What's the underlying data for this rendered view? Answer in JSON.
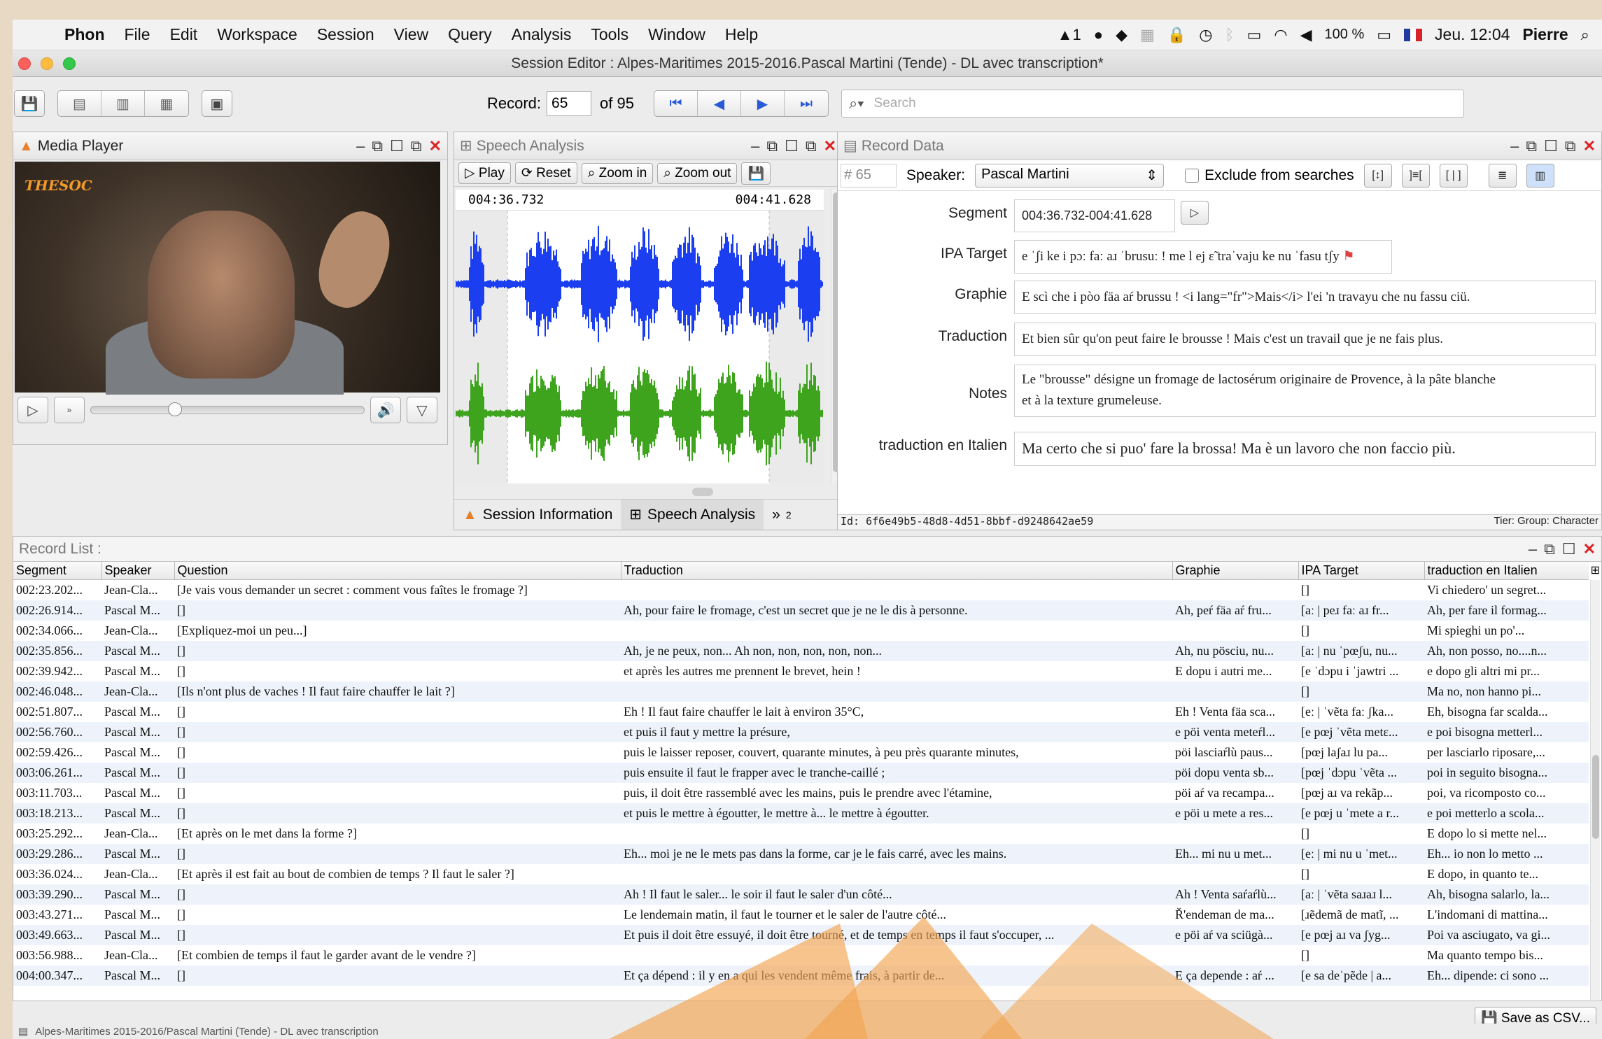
{
  "menubar": {
    "app": "Phon",
    "items": [
      "File",
      "Edit",
      "Workspace",
      "Session",
      "View",
      "Query",
      "Analysis",
      "Tools",
      "Window",
      "Help"
    ],
    "status": {
      "adobe": "1",
      "battery": "100 %",
      "clock": "Jeu. 12:04",
      "user": "Pierre"
    }
  },
  "window": {
    "title": "Session Editor : Alpes-Maritimes 2015-2016.Pascal Martini (Tende) - DL avec transcription*"
  },
  "toolbar": {
    "record_label": "Record:",
    "record_value": "65",
    "of_label": "of 95",
    "search_placeholder": "Search"
  },
  "media_player": {
    "title": "Media Player",
    "logo_text": "THESOC"
  },
  "speech_analysis": {
    "title": "Speech Analysis",
    "buttons": {
      "play": "Play",
      "reset": "Reset",
      "zoom_in": "Zoom in",
      "zoom_out": "Zoom out"
    },
    "start_time": "004:36.732",
    "end_time": "004:41.628",
    "waveform_colors": {
      "top": "#1a3ef0",
      "bottom": "#3ea41e"
    },
    "tabs": {
      "session_info": "Session Information",
      "speech_analysis": "Speech Analysis",
      "more": "»",
      "more_count": "2"
    }
  },
  "record_data": {
    "title": "Record Data",
    "record_number": "# 65",
    "speaker_label": "Speaker:",
    "speaker_value": "Pascal Martini",
    "exclude_label": "Exclude from searches",
    "fields": {
      "segment": {
        "label": "Segment",
        "value": "004:36.732-004:41.628"
      },
      "ipa_target": {
        "label": "IPA Target",
        "value": "e ˈʃi ke i pɔː faː aɹ ˈbrusuː ! me l ej ɛ̃ traˈvaju ke nu ˈfasu tʃy"
      },
      "graphie": {
        "label": "Graphie",
        "value": "E scì che i pòo fäa aŕ brussu ! <i lang=\"fr\">Mais</i> l'ei 'n travayu che nu fassu ciü."
      },
      "traduction": {
        "label": "Traduction",
        "value": "Et bien sûr qu'on peut faire le brousse ! Mais c'est un travail que je ne fais plus."
      },
      "notes": {
        "label": "Notes",
        "line1": "Le \"brousse\" désigne un fromage de lactosérum originaire de Provence, à la pâte blanche",
        "line2": "et à la texture grumeleuse."
      },
      "italien": {
        "label": "traduction en Italien",
        "value": "Ma certo che si puo' fare la brossa! Ma è un lavoro che non faccio più."
      }
    },
    "id": "Id: 6f6e49b5-48d8-4d51-8bbf-d9248642ae59",
    "tier": "Tier:  Group:  Character"
  },
  "record_list": {
    "title": "Record List :",
    "columns": [
      "Segment",
      "Speaker",
      "Question",
      "Traduction",
      "Graphie",
      "IPA Target",
      "traduction en Italien"
    ],
    "rows": [
      [
        "002:23.202...",
        "Jean-Cla...",
        "[Je vais vous demander un secret : comment vous faîtes le fromage ?]",
        "",
        "",
        "[]",
        "Vi chiedero' un segret..."
      ],
      [
        "002:26.914...",
        "Pascal M...",
        "[]",
        "Ah, pour faire le fromage, c'est un secret que je ne le dis à personne.",
        "Ah, peŕ fäa aŕ fru...",
        "[aː | peɹ faː aɹ fr...",
        "Ah, per fare il formag..."
      ],
      [
        "002:34.066...",
        "Jean-Cla...",
        "[Expliquez-moi un peu...]",
        "",
        "",
        "[]",
        "Mi spieghi un po'..."
      ],
      [
        "002:35.856...",
        "Pascal M...",
        "[]",
        "Ah, je ne peux, non... Ah non, non, non, non, non...",
        "Ah, nu pösciu, nu...",
        "[aː | nu ˈpœʃu, nu...",
        "Ah, non posso, no....n..."
      ],
      [
        "002:39.942...",
        "Pascal M...",
        "[]",
        "et après les autres me prennent le brevet, hein !",
        "E dopu i autri me...",
        "[e ˈdɔpu i ˈjawtri ...",
        "e dopo gli altri mi pr..."
      ],
      [
        "002:46.048...",
        "Jean-Cla...",
        "[Ils n'ont plus de vaches ! Il faut faire chauffer le lait ?]",
        "",
        "",
        "[]",
        "Ma no, non hanno pi..."
      ],
      [
        "002:51.807...",
        "Pascal M...",
        "[]",
        "Eh ! Il faut faire chauffer le lait à environ 35°C,",
        "Eh ! Venta fäa sca...",
        "[eː | ˈvẽta faː ʃka...",
        "Eh, bisogna far scalda..."
      ],
      [
        "002:56.760...",
        "Pascal M...",
        "[]",
        "et puis il faut y mettre la présure,",
        "e pöi venta meteŕl...",
        "[e pœj ˈvẽta metɛ...",
        "e poi bisogna metterl..."
      ],
      [
        "002:59.426...",
        "Pascal M...",
        "[]",
        "puis le laisser reposer, couvert, quarante minutes, à peu près quarante minutes,",
        "pöi lasciaŕlù paus...",
        "[pœj laʃaɹ lu pa...",
        "per lasciarlo riposare,..."
      ],
      [
        "003:06.261...",
        "Pascal M...",
        "[]",
        "puis ensuite il faut le frapper avec le tranche-caillé ;",
        "pöi dopu venta sb...",
        "[pœj ˈdɔpu ˈvẽta ...",
        "poi in seguito bisogna..."
      ],
      [
        "003:11.703...",
        "Pascal M...",
        "[]",
        "puis, il doit être rassemblé avec les mains, puis le prendre avec l'étamine,",
        "pöi aŕ va recampa...",
        "[pœj aɹ va rekãp...",
        "poi, va ricomposto co..."
      ],
      [
        "003:18.213...",
        "Pascal M...",
        "[]",
        "et puis le mettre à égoutter, le mettre à... le mettre à égoutter.",
        "e pöi u mete a res...",
        "[e pœj u ˈmete a r...",
        "e poi metterlo a scola..."
      ],
      [
        "003:25.292...",
        "Jean-Cla...",
        "[Et après on le met dans la forme ?]",
        "",
        "",
        "[]",
        "E dopo lo si mette nel..."
      ],
      [
        "003:29.286...",
        "Pascal M...",
        "[]",
        "Eh... moi je ne le mets pas dans la forme, car je le fais carré, avec les mains.",
        "Eh... mi nu u met...",
        "[eː | mi nu u ˈmet...",
        "Eh... io non lo metto ..."
      ],
      [
        "003:36.024...",
        "Jean-Cla...",
        "[Et après il est fait au bout de combien de temps ? Il faut le saler ?]",
        "",
        "",
        "[]",
        "E dopo, in quanto te..."
      ],
      [
        "003:39.290...",
        "Pascal M...",
        "[]",
        "Ah ! Il faut le saler... le soir il faut le saler d'un côté...",
        "Ah ! Venta saŕaŕlù...",
        "[aː | ˈvẽta saɹaɹ l...",
        "Ah, bisogna salarlo, la..."
      ],
      [
        "003:43.271...",
        "Pascal M...",
        "[]",
        "Le lendemain matin, il faut le tourner et le saler de l'autre côté...",
        "Ř'endeman de ma...",
        "[ɹẽdemã de matĩ, ...",
        "L'indomani di mattina..."
      ],
      [
        "003:49.663...",
        "Pascal M...",
        "[]",
        "Et puis il doit être essuyé, il doit être tourné, et de temps en temps il faut s'occuper, ...",
        "e pöi aŕ va sciügà...",
        "[e pœj aɹ va ʃyg...",
        "Poi va asciugato, va gi..."
      ],
      [
        "003:56.988...",
        "Jean-Cla...",
        "[Et combien de temps il faut le garder avant de le vendre ?]",
        "",
        "",
        "[]",
        "Ma quanto tempo bis..."
      ],
      [
        "004:00.347...",
        "Pascal M...",
        "[]",
        "Et ça dépend : il y en a qui les vendent même frais, à partir de...",
        "E ça depende : aŕ ...",
        "[e sa deˈpẽde | a...",
        "Eh... dipende: ci sono ..."
      ]
    ],
    "save_csv": "Save as CSV..."
  },
  "statusbar": {
    "path": "Alpes-Maritimes 2015-2016/Pascal Martini (Tende) - DL avec transcription"
  }
}
